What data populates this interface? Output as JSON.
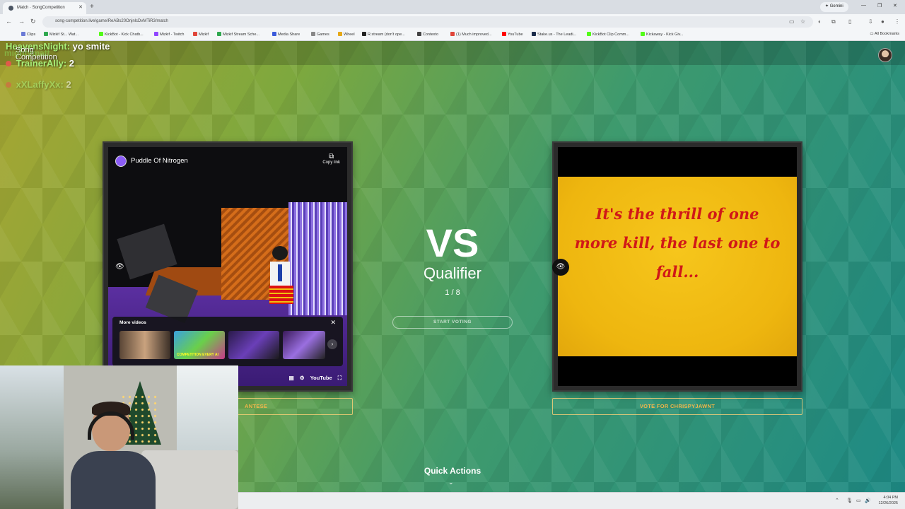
{
  "browser": {
    "tab_title": "Match · SongCompetition",
    "url": "song-competition.live/game/ReABs20OnjnlcDvMTiR3/match",
    "gemini_label": "Gemini",
    "bookmarks": [
      "Clips",
      "Mizkif St... Wat...",
      "KickBot - Kick Chatb...",
      "Mizkif - Twitch",
      "Mizkif",
      "Mizkif Stream Sche...",
      "Media Share",
      "Games",
      "Wheel",
      "R.stream (don't ope...",
      "Contexto",
      "(1) Much improved...",
      "YouTube",
      "Stake.us - The Leadi...",
      "KickBot Clip Comm...",
      "Kickaway - Kick Giv..."
    ],
    "all_bookmarks": "All Bookmarks"
  },
  "overlay": {
    "stream_name": "mightymatt",
    "brand": [
      "Song",
      "Competition"
    ],
    "chat": [
      {
        "name": "HeavensNight:",
        "message": "yo smite"
      },
      {
        "name": "TrainerAlly:",
        "message": "2"
      },
      {
        "name": "xXLaffyXx:",
        "message": "2"
      }
    ]
  },
  "match": {
    "left": {
      "video_title": "Puddle Of Nitrogen",
      "copy_link": "Copy link",
      "more_videos": "More videos",
      "thumb_caption": "COMPETITION EVERY AI",
      "platform": "YouTube",
      "vote_label": "ANTESE"
    },
    "center": {
      "vs": "VS",
      "round": "Qualifier",
      "progress": "1 / 8",
      "start_voting": "START VOTING"
    },
    "right": {
      "lyric": "It's the thrill of one more kill, the last one to fall...",
      "vote_label": "VOTE FOR CHRISPYJAWNT"
    },
    "quick_actions": "Quick Actions"
  },
  "taskbar": {
    "time": "4:04 PM",
    "date": "12/26/2025"
  }
}
